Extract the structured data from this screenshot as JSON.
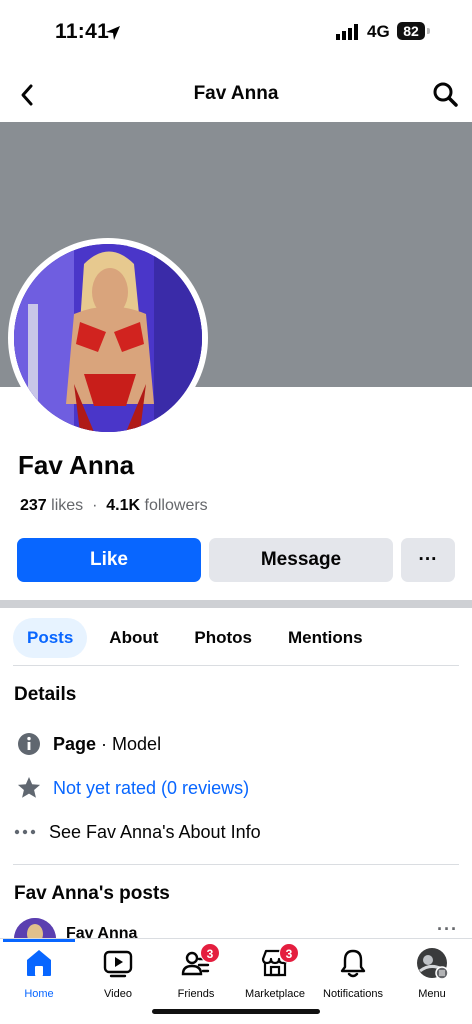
{
  "status_bar": {
    "time": "11:41",
    "network": "4G",
    "battery": "82"
  },
  "header": {
    "title": "Fav Anna"
  },
  "profile": {
    "name": "Fav Anna",
    "likes_count": "237",
    "likes_label": "likes",
    "separator": "·",
    "followers_count": "4.1K",
    "followers_label": "followers"
  },
  "actions": {
    "like": "Like",
    "message": "Message",
    "more": "···"
  },
  "tabs": [
    {
      "label": "Posts",
      "active": true
    },
    {
      "label": "About",
      "active": false
    },
    {
      "label": "Photos",
      "active": false
    },
    {
      "label": "Mentions",
      "active": false
    }
  ],
  "details": {
    "title": "Details",
    "category_label": "Page",
    "category_value": "· Model",
    "rating": "Not yet rated (0 reviews)",
    "about_link": "See Fav Anna's About Info"
  },
  "posts": {
    "title": "Fav Anna's posts",
    "author": "Fav Anna",
    "more": "···"
  },
  "bottom_nav": [
    {
      "label": "Home",
      "icon": "home-icon",
      "active": true
    },
    {
      "label": "Video",
      "icon": "video-icon",
      "active": false
    },
    {
      "label": "Friends",
      "icon": "friends-icon",
      "badge": "3",
      "active": false
    },
    {
      "label": "Marketplace",
      "icon": "marketplace-icon",
      "badge": "3",
      "active": false
    },
    {
      "label": "Notifications",
      "icon": "bell-icon",
      "active": false
    },
    {
      "label": "Menu",
      "icon": "menu-avatar-icon",
      "active": false
    }
  ],
  "colors": {
    "accent": "#0866ff",
    "cover": "#898e93",
    "badge": "#e41e3f"
  }
}
